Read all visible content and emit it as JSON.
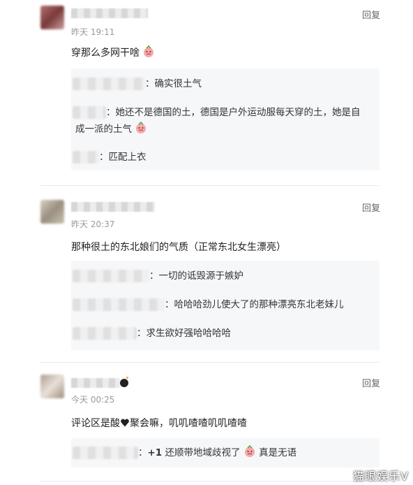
{
  "comments": [
    {
      "time": "昨天 19:11",
      "reply_label": "回复",
      "text": "穿那么多网干啥",
      "replies": [
        {
          "text": "：确实很土气"
        },
        {
          "text": "：她还不是德国的土，德国是户外运动服每天穿的土，她是自",
          "text2": "成一派的土气"
        },
        {
          "text": "：匹配上衣"
        }
      ]
    },
    {
      "time": "昨天 20:37",
      "reply_label": "回复",
      "text": "那种很土的东北娘们的气质（正常东北女生漂亮）",
      "replies": [
        {
          "text": "：一切的诋毁源于嫉妒"
        },
        {
          "text": "：哈哈哈劲儿使大了的那种漂亮东北老妹儿"
        },
        {
          "text": "：求生欲好强哈哈哈哈"
        }
      ]
    },
    {
      "time": "今天 00:25",
      "reply_label": "回复",
      "text_a": "评论区是酸",
      "text_b": "聚会嘛，叽叽喳喳叽叽喳喳",
      "replies": [
        {
          "text_a": "：",
          "plus": "+1",
          "text_b": " 还顺带地域歧视了",
          "text_c": " 真是无语"
        }
      ]
    }
  ],
  "watermark": "猫眼娱乐V",
  "icons": {
    "emoji": "crying-face-icon",
    "heart": "black-heart-icon",
    "bomb": "bomb-icon"
  }
}
